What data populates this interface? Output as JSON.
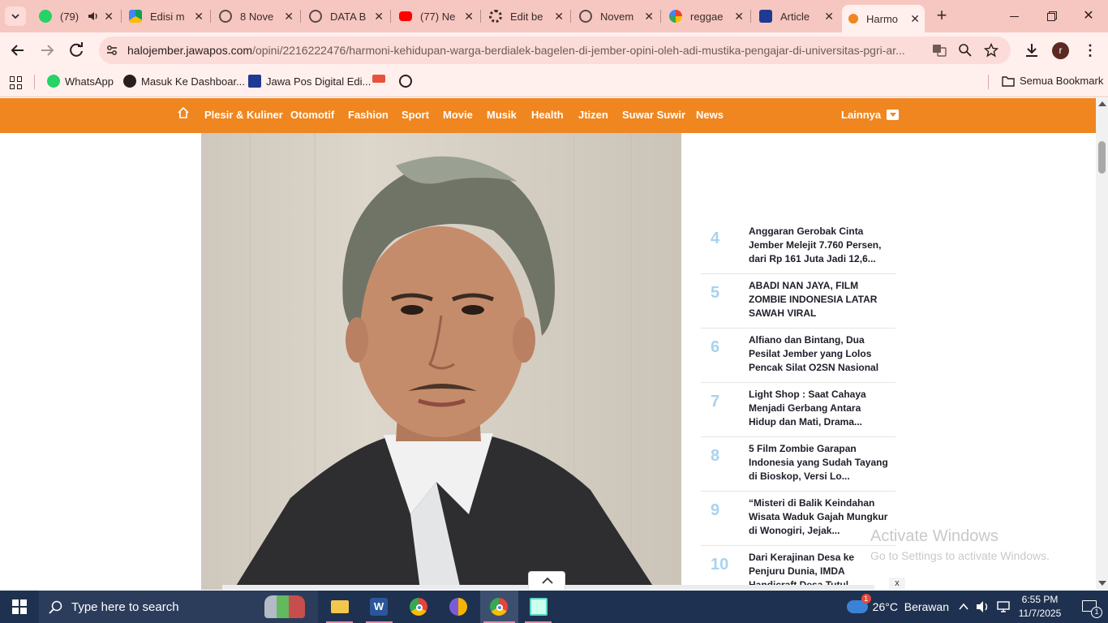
{
  "browser": {
    "tabs": [
      {
        "label": "(79)",
        "icon": "whatsapp-icon",
        "color": "#25d366"
      },
      {
        "label": "Edisi m",
        "icon": "google-drive-icon",
        "color": "#4285f4"
      },
      {
        "label": "8 Nove",
        "icon": "globe-icon",
        "color": "#5a4a4a"
      },
      {
        "label": "DATA B",
        "icon": "globe-icon",
        "color": "#5a4a4a"
      },
      {
        "label": "(77) Ne",
        "icon": "youtube-icon",
        "color": "#ff0000"
      },
      {
        "label": "Edit be",
        "icon": "gear-icon",
        "color": "#3a2a2a"
      },
      {
        "label": "Novem",
        "icon": "globe-icon",
        "color": "#5a4a4a"
      },
      {
        "label": "reggae",
        "icon": "google-icon",
        "color": "#4285f4"
      },
      {
        "label": "Article",
        "icon": "article-icon",
        "color": "#1f3a93"
      },
      {
        "label": "Harmo",
        "icon": "site-icon",
        "color": "#f0861f"
      }
    ],
    "url_host": "halojember.jawapos.com",
    "url_path": "/opini/2216222476/harmoni-kehidupan-warga-berdialek-bagelen-di-jember-opini-oleh-adi-mustika-pengajar-di-universitas-pgri-ar...",
    "profile_initial": "r",
    "bookmarks": [
      {
        "label": "WhatsApp",
        "icon": "whatsapp-icon"
      },
      {
        "label": "Masuk Ke Dashboar...",
        "icon": "globe-icon"
      },
      {
        "label": "Jawa Pos Digital Edi...",
        "icon": "jawapos-icon"
      }
    ],
    "all_bookmarks_label": "Semua Bookmark"
  },
  "site": {
    "nav": [
      "Plesir & Kuliner",
      "Otomotif",
      "Fashion",
      "Sport",
      "Movie",
      "Musik",
      "Health",
      "Jtizen",
      "Suwar Suwir",
      "News"
    ],
    "more_label": "Lainnya",
    "accent": "#f0861f",
    "trending": [
      {
        "rank": "4",
        "title": "Anggaran Gerobak Cinta Jember Melejit 7.760 Persen, dari Rp 161 Juta Jadi 12,6..."
      },
      {
        "rank": "5",
        "title": "ABADI NAN JAYA, FILM ZOMBIE INDONESIA LATAR SAWAH VIRAL"
      },
      {
        "rank": "6",
        "title": "Alfiano dan Bintang, Dua Pesilat Jember yang Lolos Pencak Silat O2SN Nasional"
      },
      {
        "rank": "7",
        "title": "Light Shop : Saat Cahaya Menjadi Gerbang Antara Hidup dan Mati, Drama..."
      },
      {
        "rank": "8",
        "title": "5 Film Zombie Garapan Indonesia yang Sudah Tayang di Bioskop, Versi Lo..."
      },
      {
        "rank": "9",
        "title": "“Misteri di Balik Keindahan Wisata Waduk Gajah Mungkur di Wonogiri, Jejak..."
      },
      {
        "rank": "10",
        "title": "Dari Kerajinan Desa ke Penjuru Dunia, IMDA Handicraft Desa Tutul..."
      }
    ],
    "close_ad_label": "x"
  },
  "watermark": {
    "title": "Activate Windows",
    "subtitle": "Go to Settings to activate Windows."
  },
  "taskbar": {
    "search_placeholder": "Type here to search",
    "weather": "26°C  Berawan",
    "weather_badge": "1",
    "time": "6:55 PM",
    "date": "11/7/2025",
    "notification_count": "1"
  }
}
